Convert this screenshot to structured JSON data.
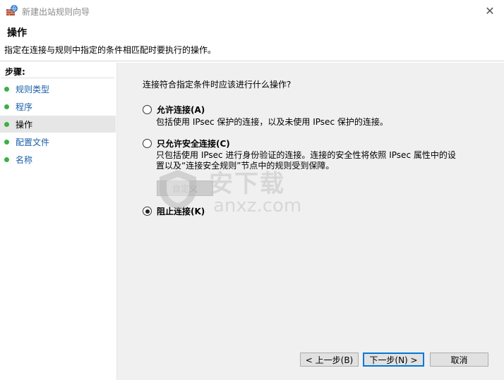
{
  "window": {
    "title": "新建出站规则向导",
    "close_glyph": "✕"
  },
  "header": {
    "title": "操作",
    "description": "指定在连接与规则中指定的条件相匹配时要执行的操作。"
  },
  "sidebar": {
    "steps_label": "步骤:",
    "items": [
      {
        "label": "规则类型"
      },
      {
        "label": "程序"
      },
      {
        "label": "操作",
        "active": true
      },
      {
        "label": "配置文件"
      },
      {
        "label": "名称"
      }
    ]
  },
  "main": {
    "question": "连接符合指定条件时应该进行什么操作?",
    "options": [
      {
        "label": "允许连接(A)",
        "description": "包括使用 IPsec 保护的连接，以及未使用 IPsec 保护的连接。",
        "checked": false
      },
      {
        "label": "只允许安全连接(C)",
        "description_line1": "只包括使用 IPsec 进行身份验证的连接。连接的安全性将依照 IPsec 属性中的设",
        "description_line2": "置以及“连接安全规则”节点中的规则受到保障。",
        "checked": false
      },
      {
        "label": "阻止连接(K)",
        "checked": true
      }
    ],
    "customize_label": "自定义"
  },
  "footer": {
    "back_label": "< 上一步(B)",
    "next_label": "下一步(N) >",
    "cancel_label": "取消"
  },
  "watermark": {
    "text": "安下载",
    "sub": "anxz.com"
  },
  "colors": {
    "accent": "#0078d7",
    "step_dot": "#3cb043",
    "link": "#1a5fa8",
    "content_bg": "#f0f0f0"
  },
  "icons": {
    "app": "firewall-icon",
    "close": "close-icon",
    "bullet": "green-dot-icon"
  }
}
